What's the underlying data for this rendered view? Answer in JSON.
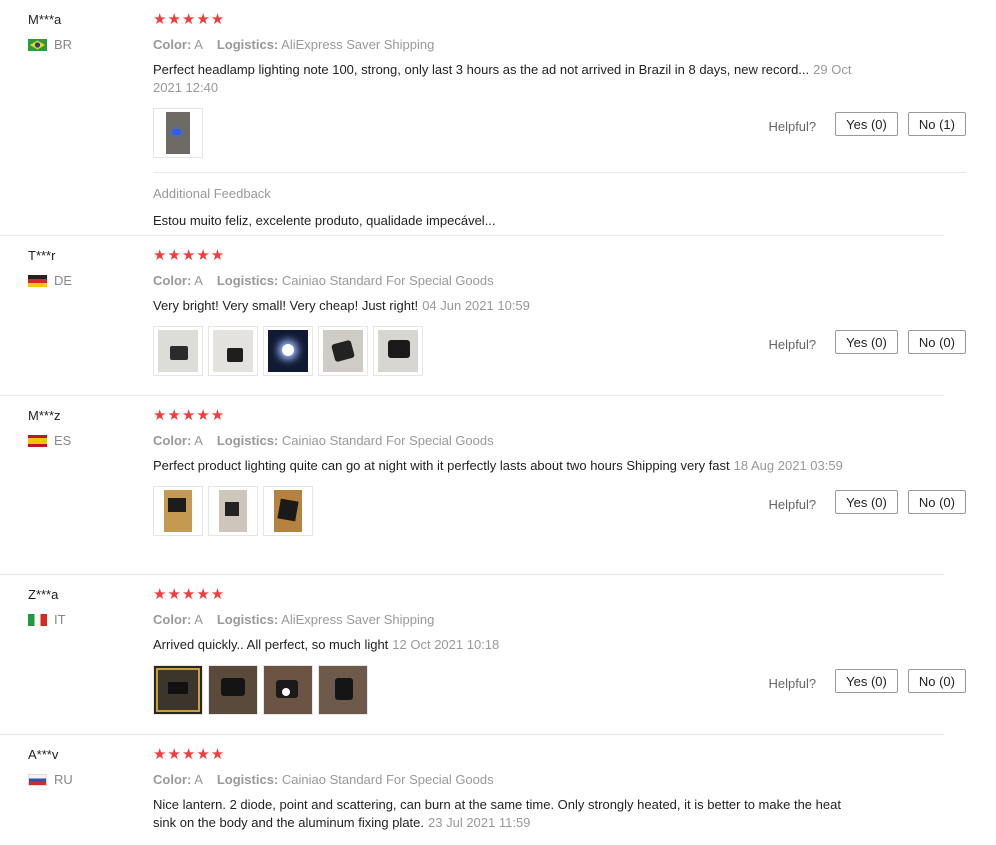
{
  "reviews": [
    {
      "user": "M***a",
      "country": "BR",
      "flag": "brazil-flag-icon",
      "stars": "★★★★★",
      "color_label": "Color:",
      "color_value": "A",
      "logistics_label": "Logistics:",
      "logistics_value": "AliExpress Saver Shipping",
      "text": "Perfect headlamp lighting note 100, strong, only last 3 hours as the ad not arrived in Brazil in 8 days, new record...",
      "date": "29 Oct 2021 12:40",
      "helpful_label": "Helpful?",
      "yes": "Yes (0)",
      "no": "No (1)",
      "feedback_title": "Additional Feedback",
      "feedback_text": "Estou muito feliz, excelente produto, qualidade impecável..."
    },
    {
      "user": "T***r",
      "country": "DE",
      "flag": "germany-flag-icon",
      "stars": "★★★★★",
      "color_label": "Color:",
      "color_value": "A",
      "logistics_label": "Logistics:",
      "logistics_value": "Cainiao Standard For Special Goods",
      "text": "Very bright! Very small! Very cheap! Just right!",
      "date": "04 Jun 2021 10:59",
      "helpful_label": "Helpful?",
      "yes": "Yes (0)",
      "no": "No (0)"
    },
    {
      "user": "M***z",
      "country": "ES",
      "flag": "spain-flag-icon",
      "stars": "★★★★★",
      "color_label": "Color:",
      "color_value": "A",
      "logistics_label": "Logistics:",
      "logistics_value": "Cainiao Standard For Special Goods",
      "text": "Perfect product lighting quite can go at night with it perfectly lasts about two hours Shipping very fast",
      "date": "18 Aug 2021 03:59",
      "helpful_label": "Helpful?",
      "yes": "Yes (0)",
      "no": "No (0)"
    },
    {
      "user": "Z***a",
      "country": "IT",
      "flag": "italy-flag-icon",
      "stars": "★★★★★",
      "color_label": "Color:",
      "color_value": "A",
      "logistics_label": "Logistics:",
      "logistics_value": "AliExpress Saver Shipping",
      "text": "Arrived quickly.. All perfect, so much light",
      "date": "12 Oct 2021 10:18",
      "helpful_label": "Helpful?",
      "yes": "Yes (0)",
      "no": "No (0)"
    },
    {
      "user": "A***v",
      "country": "RU",
      "flag": "russia-flag-icon",
      "stars": "★★★★★",
      "color_label": "Color:",
      "color_value": "A",
      "logistics_label": "Logistics:",
      "logistics_value": "Cainiao Standard For Special Goods",
      "text": "Nice lantern. 2 diode, point and scattering, can burn at the same time. Only strongly heated, it is better to make the heat sink on the body and the aluminum fixing plate.",
      "date": "23 Jul 2021 11:59"
    }
  ],
  "colors": {
    "star": "#f23b3b",
    "muted": "#999999",
    "border": "#e8e8e8"
  }
}
